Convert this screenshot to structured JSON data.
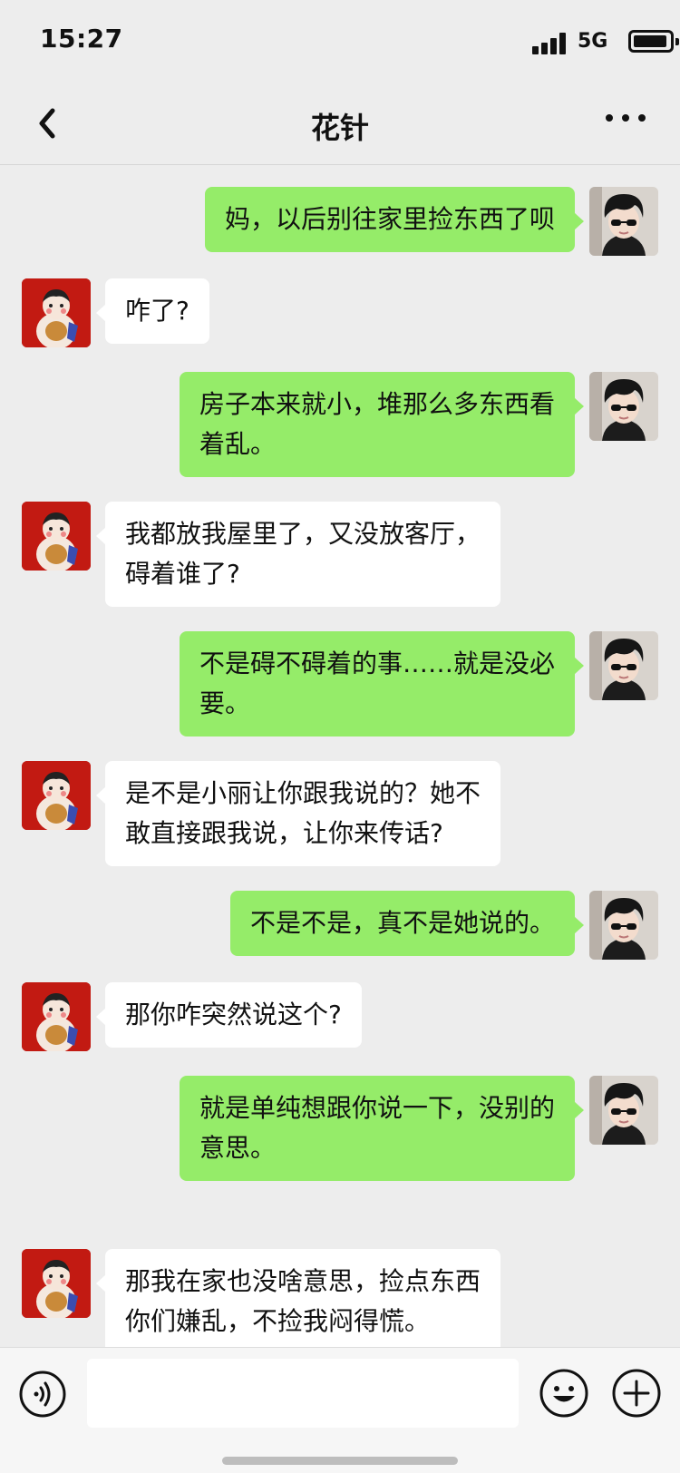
{
  "status_bar": {
    "time": "15:27",
    "network": "5G"
  },
  "nav": {
    "title": "花针",
    "back_icon": "chevron-left-icon",
    "more_icon": "more-dots-icon"
  },
  "colors": {
    "outgoing_bubble": "#95ec69",
    "incoming_bubble": "#ffffff",
    "background": "#ededed"
  },
  "messages": [
    {
      "side": "me",
      "lines": [
        "妈，以后别往家里捡东西了呗"
      ]
    },
    {
      "side": "them",
      "lines": [
        "咋了?"
      ]
    },
    {
      "side": "me",
      "lines": [
        "房子本来就小，堆那么多东西看",
        "着乱。"
      ]
    },
    {
      "side": "them",
      "lines": [
        "我都放我屋里了，又没放客厅，",
        "碍着谁了?"
      ]
    },
    {
      "side": "me",
      "lines": [
        "不是碍不碍着的事……就是没必",
        "要。"
      ]
    },
    {
      "side": "them",
      "lines": [
        "是不是小丽让你跟我说的？她不",
        "敢直接跟我说，让你来传话?"
      ]
    },
    {
      "side": "me",
      "lines": [
        "不是不是，真不是她说的。"
      ]
    },
    {
      "side": "them",
      "lines": [
        "那你咋突然说这个?"
      ]
    },
    {
      "side": "me",
      "lines": [
        "就是单纯想跟你说一下，没别的",
        "意思。"
      ]
    },
    {
      "side": "them",
      "lines": [
        "那我在家也没啥意思，捡点东西",
        "你们嫌乱，不捡我闷得慌。"
      ]
    }
  ],
  "input_bar": {
    "placeholder": "",
    "voice_icon": "voice-icon",
    "emoji_icon": "emoji-icon",
    "plus_icon": "plus-icon"
  }
}
